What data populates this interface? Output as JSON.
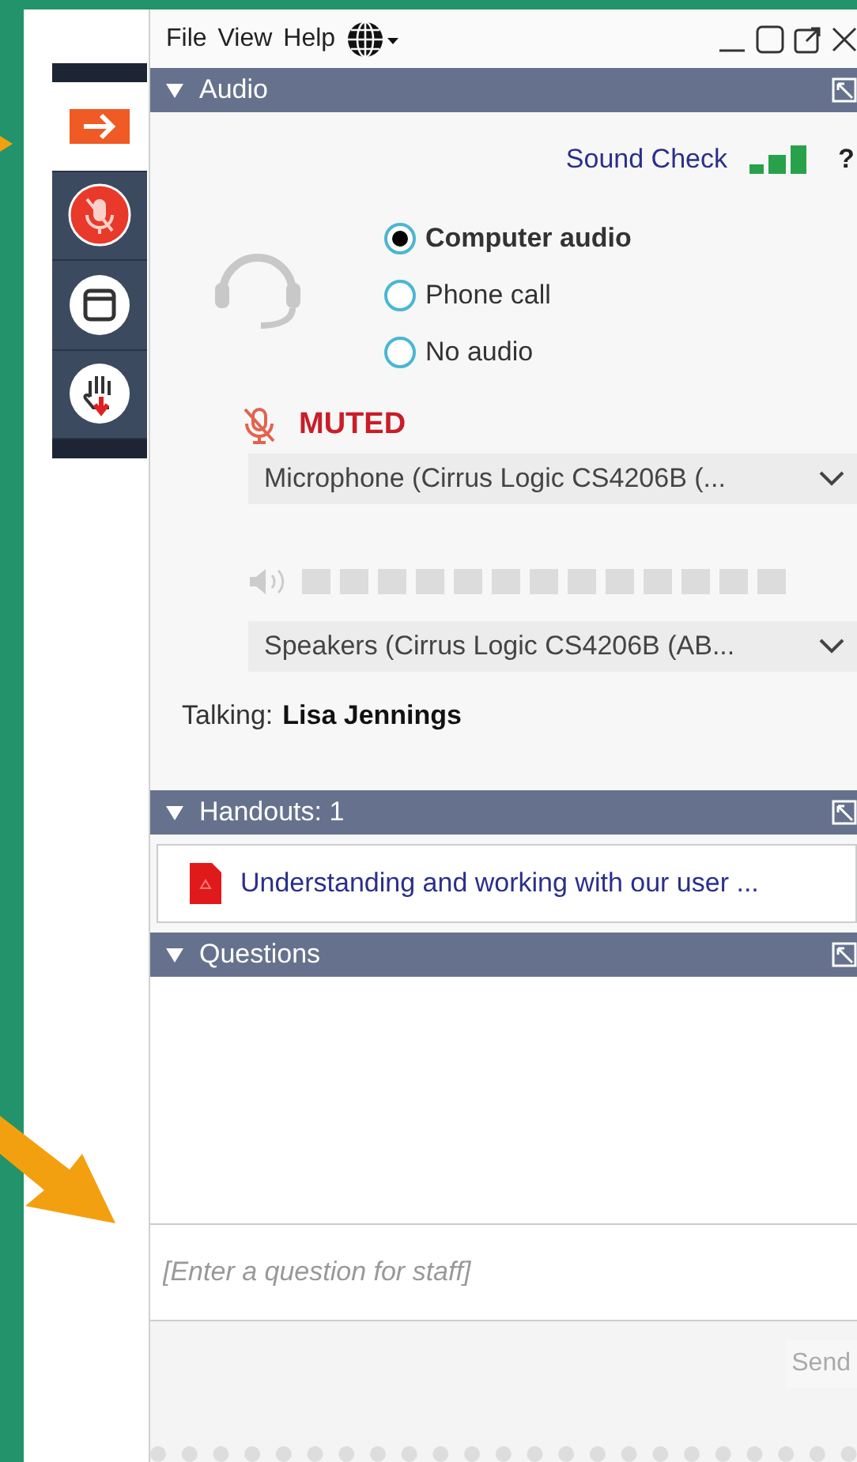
{
  "menu": [
    {
      "label": "File"
    },
    {
      "label": "View"
    },
    {
      "label": "Help"
    }
  ],
  "toolbar": [
    {
      "kind": "leave",
      "selected": true
    },
    {
      "kind": "mic",
      "selected": false
    },
    {
      "kind": "screen",
      "selected": false
    },
    {
      "kind": "hand",
      "selected": false
    }
  ],
  "audio": {
    "title": "Audio",
    "expanded": true,
    "sound_check": "Sound Check",
    "help": "?",
    "options": [
      {
        "label": "Computer audio",
        "selected": true
      },
      {
        "label": "Phone call",
        "selected": false
      },
      {
        "label": "No audio",
        "selected": false
      }
    ],
    "mute_label": "MUTED",
    "microphone": "Microphone (Cirrus Logic CS4206B (...",
    "speakers": "Speakers (Cirrus Logic CS4206B (AB...",
    "talking_label": "Talking:",
    "talking_name": "Lisa Jennings"
  },
  "handouts": {
    "title": "Handouts: 1",
    "expanded": true,
    "items": [
      {
        "label": "Understanding and working with our user ..."
      }
    ]
  },
  "questions": {
    "title": "Questions",
    "expanded": true,
    "placeholder": "[Enter a question for staff]",
    "send": "Send"
  }
}
